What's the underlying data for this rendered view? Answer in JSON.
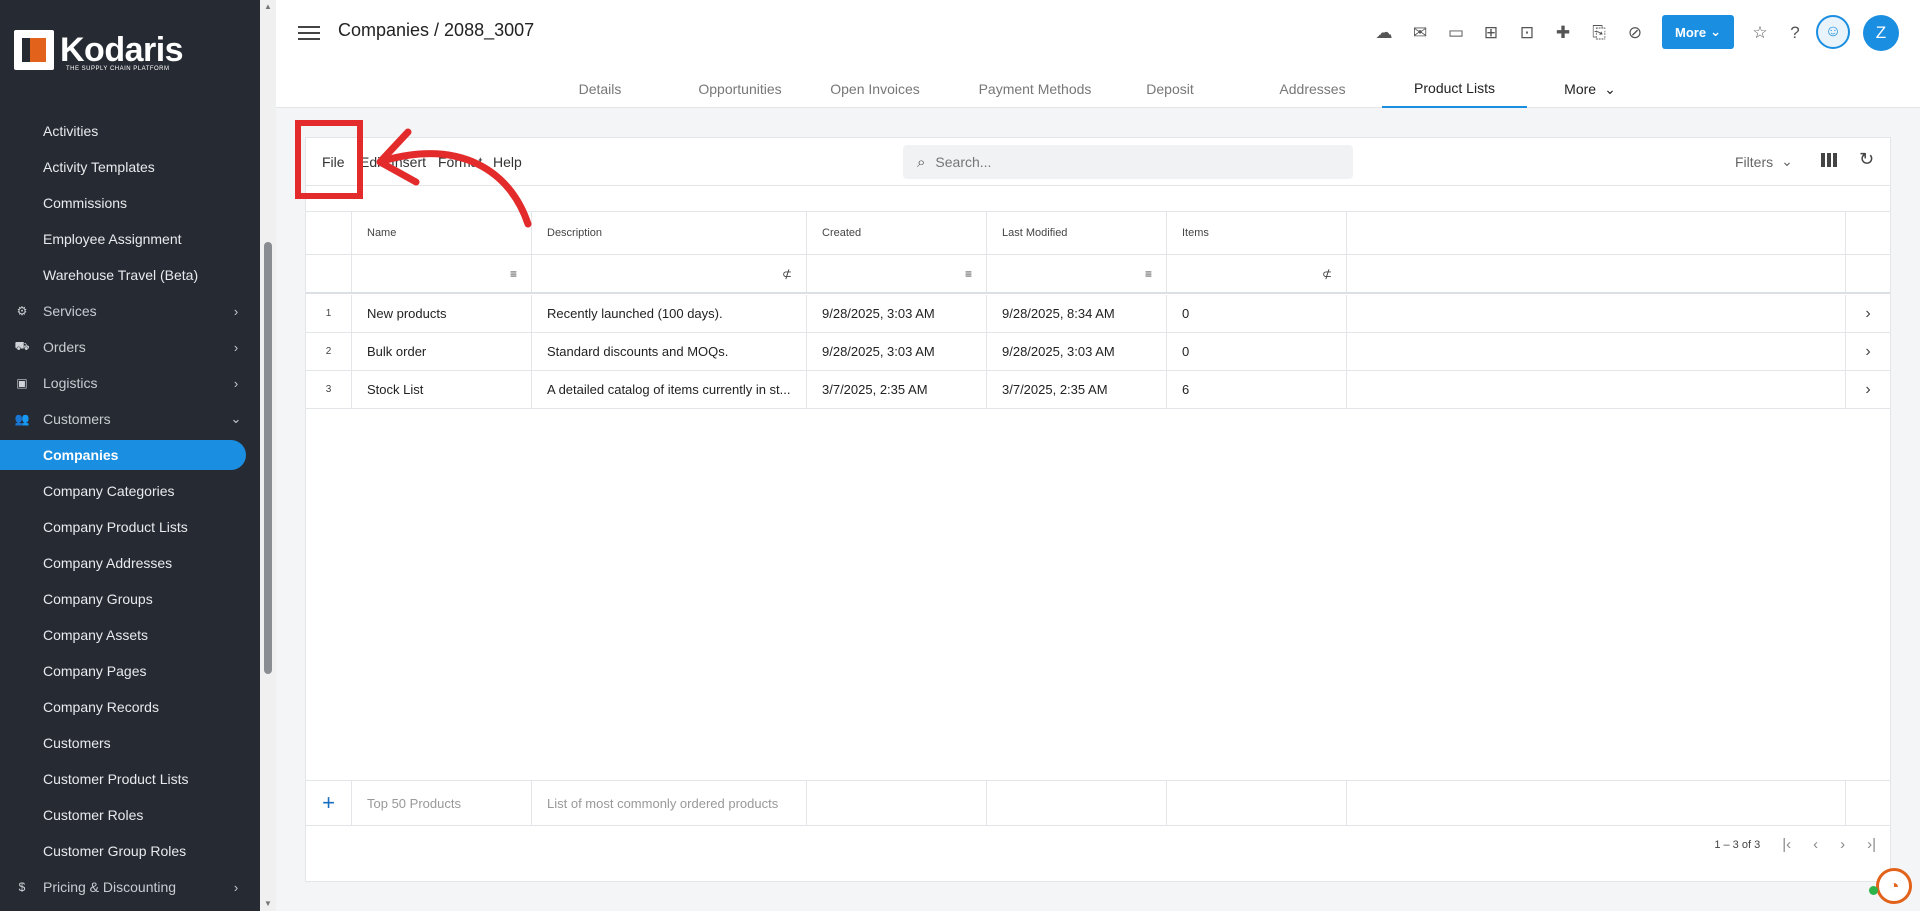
{
  "brand": {
    "name": "Kodaris",
    "tagline": "THE SUPPLY CHAIN PLATFORM"
  },
  "sidebar": {
    "items": [
      {
        "label": "Activities",
        "type": "sub"
      },
      {
        "label": "Activity Templates",
        "type": "sub"
      },
      {
        "label": "Commissions",
        "type": "sub"
      },
      {
        "label": "Employee Assignment",
        "type": "sub"
      },
      {
        "label": "Warehouse Travel (Beta)",
        "type": "sub"
      },
      {
        "label": "Services",
        "type": "section",
        "icon": "services-icon",
        "chevron": "›"
      },
      {
        "label": "Orders",
        "type": "section",
        "icon": "truck-icon",
        "chevron": "›"
      },
      {
        "label": "Logistics",
        "type": "section",
        "icon": "shipping-icon",
        "chevron": "›"
      },
      {
        "label": "Customers",
        "type": "section",
        "icon": "people-icon",
        "chevron": "⌄"
      },
      {
        "label": "Companies",
        "type": "sub",
        "active": true
      },
      {
        "label": "Company Categories",
        "type": "sub"
      },
      {
        "label": "Company Product Lists",
        "type": "sub"
      },
      {
        "label": "Company Addresses",
        "type": "sub"
      },
      {
        "label": "Company Groups",
        "type": "sub"
      },
      {
        "label": "Company Assets",
        "type": "sub"
      },
      {
        "label": "Company Pages",
        "type": "sub"
      },
      {
        "label": "Company Records",
        "type": "sub"
      },
      {
        "label": "Customers",
        "type": "sub"
      },
      {
        "label": "Customer Product Lists",
        "type": "sub"
      },
      {
        "label": "Customer Roles",
        "type": "sub"
      },
      {
        "label": "Customer Group Roles",
        "type": "sub"
      },
      {
        "label": "Pricing & Discounting",
        "type": "section",
        "icon": "dollar-icon",
        "chevron": "›"
      }
    ]
  },
  "header": {
    "breadcrumb": "Companies / 2088_3007",
    "more_label": "More",
    "avatar_initial": "Z",
    "toolbar_icons": [
      "cloud-upload-icon",
      "mail-icon",
      "payment-icon",
      "gift-icon",
      "add-to-screen-icon",
      "add-person-icon",
      "add-file-icon",
      "attachment-icon"
    ]
  },
  "tabs": [
    {
      "label": "Details"
    },
    {
      "label": "Opportunities"
    },
    {
      "label": "Open Invoices"
    },
    {
      "label": "Payment Methods"
    },
    {
      "label": "Deposit"
    },
    {
      "label": "Addresses"
    },
    {
      "label": "Product Lists",
      "active": true
    },
    {
      "label": "More"
    }
  ],
  "menubar": {
    "items": [
      "File",
      "Edit",
      "Insert",
      "Format",
      "Help"
    ],
    "search_placeholder": "Search...",
    "filters_label": "Filters"
  },
  "table": {
    "columns": [
      "Name",
      "Description",
      "Created",
      "Last Modified",
      "Items"
    ],
    "rows": [
      {
        "num": "1",
        "name": "New products",
        "description": "Recently launched (100 days).",
        "created": "9/28/2025, 3:03 AM",
        "modified": "9/28/2025, 8:34 AM",
        "items": "0"
      },
      {
        "num": "2",
        "name": "Bulk order",
        "description": "Standard discounts and MOQs.",
        "created": "9/28/2025, 3:03 AM",
        "modified": "9/28/2025, 3:03 AM",
        "items": "0"
      },
      {
        "num": "3",
        "name": "Stock List",
        "description": "A detailed catalog of items currently in st...",
        "created": "3/7/2025, 2:35 AM",
        "modified": "3/7/2025, 2:35 AM",
        "items": "6"
      }
    ],
    "new_row": {
      "name_placeholder": "Top 50 Products",
      "description_placeholder": "List of most commonly ordered products"
    },
    "pagination": "1 – 3 of 3"
  },
  "colors": {
    "accent": "#1a8ee0",
    "sidebar_bg": "#262b33",
    "annotation": "#e32b2b",
    "brand_orange": "#e2621b"
  }
}
